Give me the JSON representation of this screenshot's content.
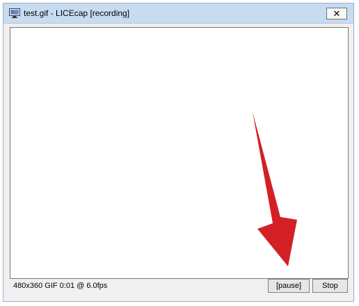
{
  "window": {
    "title": "test.gif - LICEcap [recording]",
    "close_glyph": "✕",
    "app_icon": "licecap-app-icon"
  },
  "status": {
    "text": "480x360 GIF 0:01 @ 6.0fps"
  },
  "buttons": {
    "pause_label": "[pause]",
    "stop_label": "Stop"
  },
  "colors": {
    "titlebar": "#c7dcf1",
    "chrome": "#f0f0f0",
    "arrow": "#d32026"
  }
}
